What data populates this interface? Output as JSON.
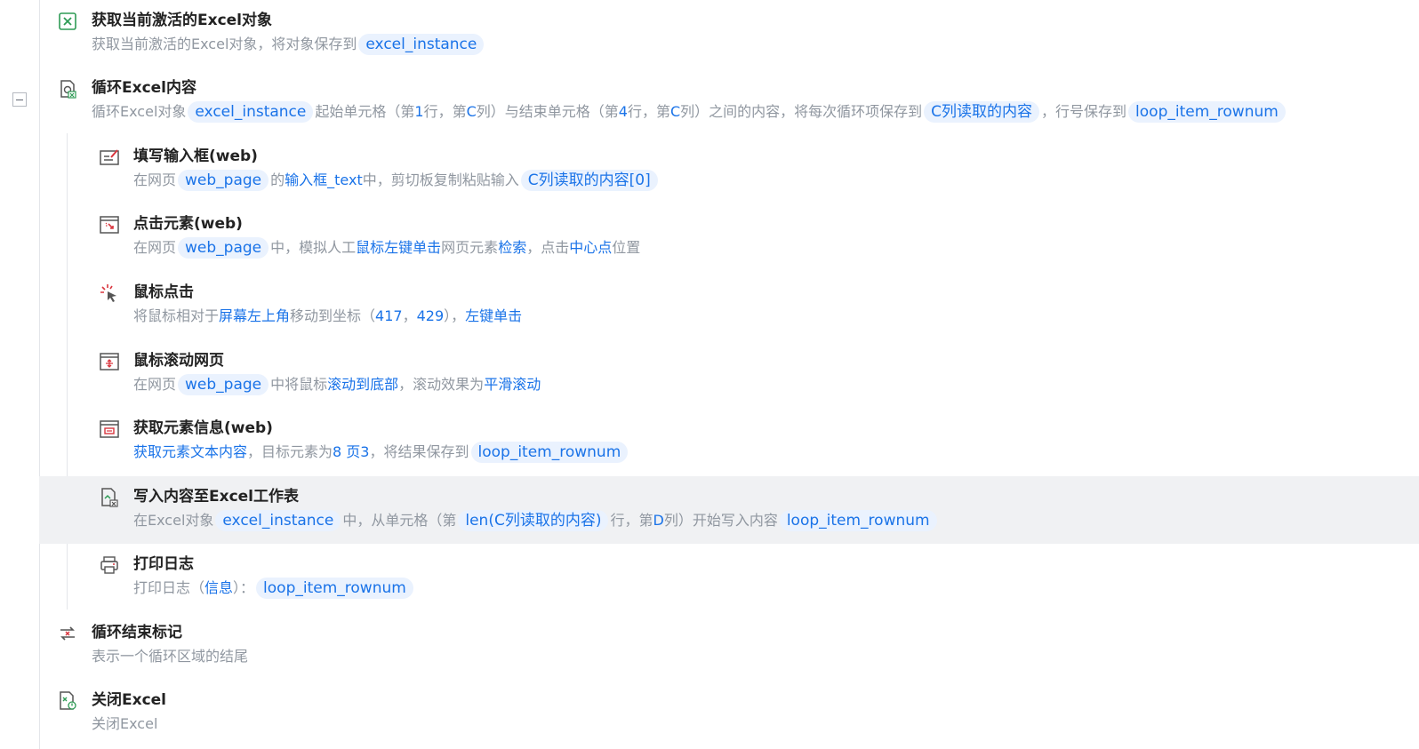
{
  "steps": [
    {
      "id": "get-excel",
      "icon": "excel-icon",
      "title": "获取当前激活的Excel对象",
      "desc": [
        {
          "t": "获取当前激活的Excel对象，将对象保存到"
        },
        {
          "t": "excel_instance",
          "k": "chip"
        }
      ]
    },
    {
      "id": "loop-excel",
      "icon": "loop-excel-icon",
      "title": "循环Excel内容",
      "desc": [
        {
          "t": "循环Excel对象"
        },
        {
          "t": "excel_instance",
          "k": "chip"
        },
        {
          "t": "起始单元格（第"
        },
        {
          "t": "1",
          "k": "hl"
        },
        {
          "t": "行，第"
        },
        {
          "t": "C",
          "k": "hl"
        },
        {
          "t": "列）与结束单元格（第"
        },
        {
          "t": "4",
          "k": "hl"
        },
        {
          "t": "行，第"
        },
        {
          "t": "C",
          "k": "hl"
        },
        {
          "t": "列）之间的内容，将每次循环项保存到"
        },
        {
          "t": "C列读取的内容",
          "k": "chip"
        },
        {
          "t": "，行号保存到"
        },
        {
          "t": "loop_item_rownum",
          "k": "chip"
        }
      ]
    },
    {
      "id": "fill-input",
      "icon": "input-edit-icon",
      "title": "填写输入框(web)",
      "desc": [
        {
          "t": "在网页"
        },
        {
          "t": "web_page",
          "k": "chip"
        },
        {
          "t": "的"
        },
        {
          "t": "输入框_text",
          "k": "hl"
        },
        {
          "t": "中，剪切板复制粘贴输入"
        },
        {
          "t": "C列读取的内容[0]",
          "k": "chip"
        }
      ]
    },
    {
      "id": "click-element",
      "icon": "click-element-icon",
      "title": "点击元素(web)",
      "desc": [
        {
          "t": "在网页"
        },
        {
          "t": "web_page",
          "k": "chip"
        },
        {
          "t": "中，模拟人工"
        },
        {
          "t": "鼠标左键单击",
          "k": "hl"
        },
        {
          "t": "网页元素"
        },
        {
          "t": "检索",
          "k": "hl"
        },
        {
          "t": "，点击"
        },
        {
          "t": "中心点",
          "k": "hl"
        },
        {
          "t": "位置"
        }
      ]
    },
    {
      "id": "mouse-click",
      "icon": "mouse-click-icon",
      "title": "鼠标点击",
      "desc": [
        {
          "t": "将鼠标相对于"
        },
        {
          "t": "屏幕左上角",
          "k": "hl"
        },
        {
          "t": "移动到坐标（"
        },
        {
          "t": "417",
          "k": "hl"
        },
        {
          "t": "，"
        },
        {
          "t": "429",
          "k": "hl"
        },
        {
          "t": "），"
        },
        {
          "t": "左键单击",
          "k": "hl"
        }
      ]
    },
    {
      "id": "scroll-page",
      "icon": "scroll-page-icon",
      "title": "鼠标滚动网页",
      "desc": [
        {
          "t": "在网页"
        },
        {
          "t": "web_page",
          "k": "chip"
        },
        {
          "t": "中将鼠标"
        },
        {
          "t": "滚动到底部",
          "k": "hl"
        },
        {
          "t": "，滚动效果为"
        },
        {
          "t": "平滑滚动",
          "k": "hl"
        }
      ]
    },
    {
      "id": "get-element-info",
      "icon": "element-info-icon",
      "title": "获取元素信息(web)",
      "desc": [
        {
          "t": "获取元素文本内容",
          "k": "hl"
        },
        {
          "t": "，目标元素为"
        },
        {
          "t": "8 页3",
          "k": "hl"
        },
        {
          "t": "，将结果保存到"
        },
        {
          "t": "loop_item_rownum",
          "k": "chip"
        }
      ]
    },
    {
      "id": "write-excel",
      "icon": "excel-write-icon",
      "title": "写入内容至Excel工作表",
      "desc": [
        {
          "t": "在Excel对象"
        },
        {
          "t": "excel_instance",
          "k": "chip"
        },
        {
          "t": "中，从单元格（第"
        },
        {
          "t": "len(C列读取的内容)",
          "k": "chip"
        },
        {
          "t": "行，第"
        },
        {
          "t": "D",
          "k": "hl"
        },
        {
          "t": "列）开始写入内容"
        },
        {
          "t": "loop_item_rownum",
          "k": "chip"
        }
      ]
    },
    {
      "id": "print-log",
      "icon": "printer-icon",
      "title": "打印日志",
      "desc": [
        {
          "t": "打印日志（"
        },
        {
          "t": "信息",
          "k": "hl"
        },
        {
          "t": "）："
        },
        {
          "t": "loop_item_rownum",
          "k": "chip"
        }
      ]
    },
    {
      "id": "loop-end",
      "icon": "loop-end-icon",
      "title": "循环结束标记",
      "desc": [
        {
          "t": "表示一个循环区域的结尾"
        }
      ]
    },
    {
      "id": "close-excel",
      "icon": "excel-close-icon",
      "title": "关闭Excel",
      "desc": [
        {
          "t": "关闭Excel"
        }
      ]
    }
  ]
}
